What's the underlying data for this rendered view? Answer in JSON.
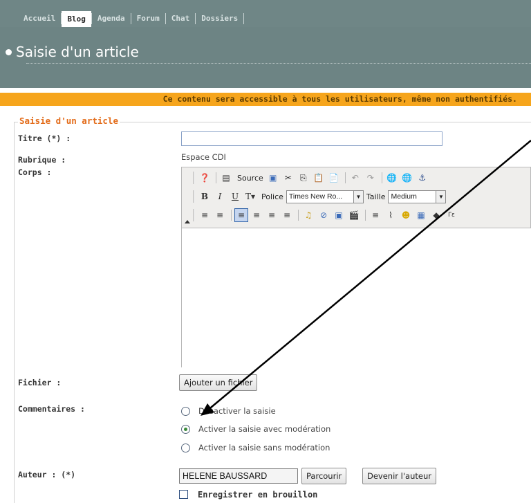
{
  "nav": {
    "items": [
      {
        "label": "Accueil",
        "active": false
      },
      {
        "label": "Blog",
        "active": true
      },
      {
        "label": "Agenda",
        "active": false
      },
      {
        "label": "Forum",
        "active": false
      },
      {
        "label": "Chat",
        "active": false
      },
      {
        "label": "Dossiers",
        "active": false
      }
    ]
  },
  "page": {
    "title": "Saisie d'un article"
  },
  "notice": "Ce contenu sera accessible à tous les utilisateurs, même non authentifiés.",
  "form": {
    "legend": "Saisie d'un article",
    "title_label": "Titre (*) :",
    "title_value": "",
    "rubrique_label": "Rubrique :",
    "rubrique_value": "Espace CDI",
    "corps_label": "Corps :",
    "fichier_label": "Fichier :",
    "add_file_button": "Ajouter un fichier",
    "comments_label": "Commentaires :",
    "comment_options": [
      {
        "label": "Désactiver la saisie",
        "checked": false
      },
      {
        "label": "Activer la saisie avec modération",
        "checked": true
      },
      {
        "label": "Activer la saisie sans modération",
        "checked": false
      }
    ],
    "author_label": "Auteur : (*)",
    "author_value": "HELENE BAUSSARD",
    "browse_button": "Parcourir",
    "become_author_button": "Devenir l'auteur",
    "draft_label": "Enregistrer en brouillon",
    "draft_checked": false
  },
  "editor": {
    "source_label": "Source",
    "font_label": "Police",
    "font_value": "Times New Ro...",
    "size_label": "Taille",
    "size_value": "Medium"
  },
  "colors": {
    "header": "#6d8484",
    "notice": "#f6a51c",
    "legend": "#e36c1a"
  }
}
